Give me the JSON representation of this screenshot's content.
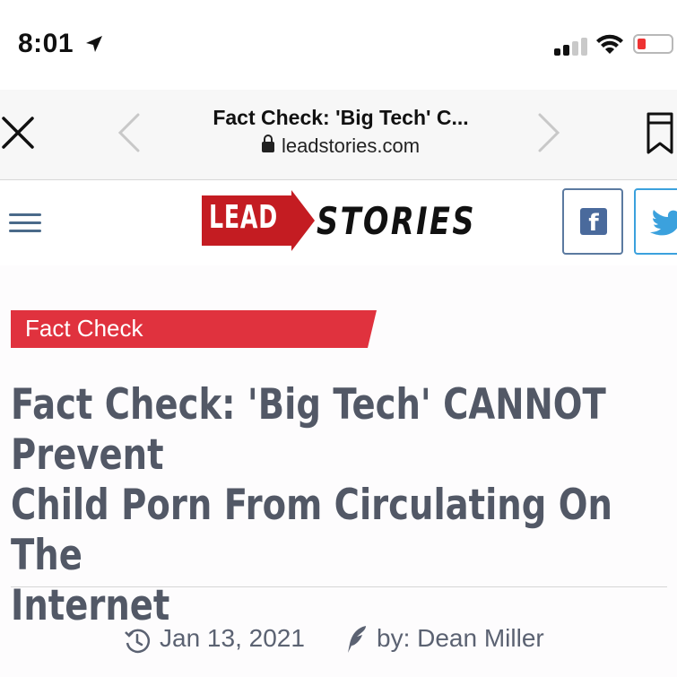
{
  "status_bar": {
    "time": "8:01"
  },
  "browser": {
    "page_title": "Fact Check: 'Big Tech' C...",
    "domain": "leadstories.com"
  },
  "site": {
    "logo_lead": "LEAD",
    "logo_stories": "STORIES",
    "facebook_glyph": "f"
  },
  "article": {
    "category_tag": "Fact Check",
    "headline_lines": [
      "Fact Check: 'Big Tech' CANNOT Prevent",
      "Child Porn From Circulating On The",
      "Internet"
    ],
    "date": "Jan 13, 2021",
    "byline": "by: Dean Miller"
  },
  "colors": {
    "brand_red": "#c41c22",
    "tag_red": "#e0323e",
    "headline_gray": "#525866",
    "facebook_blue": "#4a6a9c",
    "twitter_blue": "#3ba1dd"
  }
}
